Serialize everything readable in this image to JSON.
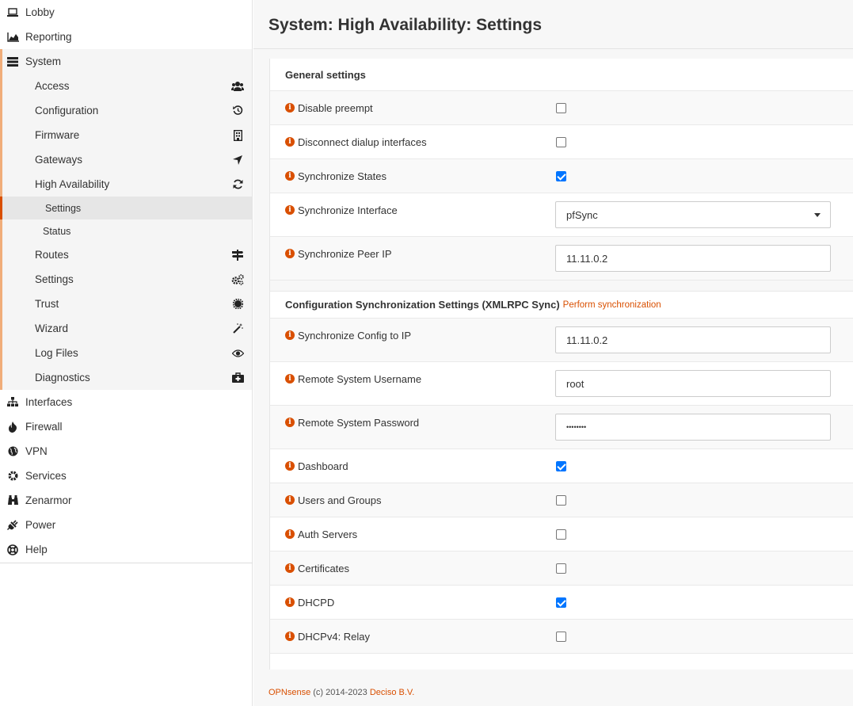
{
  "sidebar": {
    "top_items": [
      {
        "label": "Lobby",
        "icon": "laptop-icon"
      },
      {
        "label": "Reporting",
        "icon": "area-chart-icon"
      }
    ],
    "system": {
      "label": "System",
      "icon": "server-icon",
      "items": [
        {
          "label": "Access",
          "icon": "users-icon"
        },
        {
          "label": "Configuration",
          "icon": "history-icon"
        },
        {
          "label": "Firmware",
          "icon": "building-icon"
        },
        {
          "label": "Gateways",
          "icon": "location-arrow-icon"
        },
        {
          "label": "High Availability",
          "icon": "refresh-icon"
        }
      ],
      "ha_children": [
        {
          "label": "Settings"
        },
        {
          "label": "Status"
        }
      ],
      "items_after": [
        {
          "label": "Routes",
          "icon": "map-signs-icon"
        },
        {
          "label": "Settings",
          "icon": "cogs-icon"
        },
        {
          "label": "Trust",
          "icon": "certificate-icon"
        },
        {
          "label": "Wizard",
          "icon": "magic-icon"
        },
        {
          "label": "Log Files",
          "icon": "eye-icon"
        },
        {
          "label": "Diagnostics",
          "icon": "medkit-icon"
        }
      ]
    },
    "bottom_items": [
      {
        "label": "Interfaces",
        "icon": "sitemap-icon"
      },
      {
        "label": "Firewall",
        "icon": "fire-icon"
      },
      {
        "label": "VPN",
        "icon": "globe-icon"
      },
      {
        "label": "Services",
        "icon": "cog-icon"
      },
      {
        "label": "Zenarmor",
        "icon": "binoculars-icon"
      },
      {
        "label": "Power",
        "icon": "plug-icon"
      },
      {
        "label": "Help",
        "icon": "life-ring-icon"
      }
    ]
  },
  "header": {
    "title": "System: High Availability: Settings"
  },
  "general": {
    "title": "General settings",
    "rows": [
      {
        "label": "Disable preempt",
        "type": "checkbox",
        "checked": false
      },
      {
        "label": "Disconnect dialup interfaces",
        "type": "checkbox",
        "checked": false
      },
      {
        "label": "Synchronize States",
        "type": "checkbox",
        "checked": true
      },
      {
        "label": "Synchronize Interface",
        "type": "select",
        "value": "pfSync"
      },
      {
        "label": "Synchronize Peer IP",
        "type": "text",
        "value": "11.11.0.2"
      }
    ]
  },
  "sync": {
    "title": "Configuration Synchronization Settings (XMLRPC Sync)",
    "link": "Perform synchronization",
    "rows": [
      {
        "label": "Synchronize Config to IP",
        "type": "text",
        "value": "11.11.0.2"
      },
      {
        "label": "Remote System Username",
        "type": "text",
        "value": "root"
      },
      {
        "label": "Remote System Password",
        "type": "password",
        "value": "••••••••"
      },
      {
        "label": "Dashboard",
        "type": "checkbox",
        "checked": true
      },
      {
        "label": "Users and Groups",
        "type": "checkbox",
        "checked": false
      },
      {
        "label": "Auth Servers",
        "type": "checkbox",
        "checked": false
      },
      {
        "label": "Certificates",
        "type": "checkbox",
        "checked": false
      },
      {
        "label": "DHCPD",
        "type": "checkbox",
        "checked": true
      },
      {
        "label": "DHCPv4: Relay",
        "type": "checkbox",
        "checked": false
      }
    ]
  },
  "footer": {
    "brand": "OPNsense",
    "text": " (c) 2014-2023 ",
    "company": "Deciso B.V."
  },
  "colors": {
    "accent": "#d94f00",
    "checkbox": "#0075ff"
  }
}
